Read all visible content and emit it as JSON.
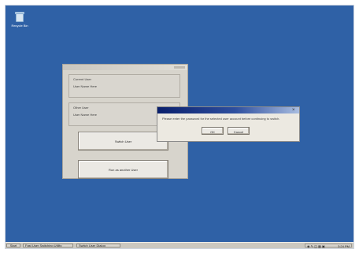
{
  "desktop": {
    "icon_label": "Recycle Bin"
  },
  "app_window": {
    "group1_title": "Current User",
    "group1_value": "User Name Here",
    "group2_title": "Other User",
    "group2_value": "User Name Here",
    "button1_label": "Switch User",
    "button2_label": "Run as another User"
  },
  "dialog": {
    "message": "Please enter the password for the selected user account before continuing to switch.",
    "ok_label": "OK",
    "cancel_label": "Cancel"
  },
  "taskbar": {
    "start_label": "Start",
    "task1_label": "Fast User Switching Utility",
    "task2_label": "Switch User Dialog",
    "tray_icons": "◉ ✎ ◫ ▦ ▣",
    "clock": "3:24 PM"
  }
}
